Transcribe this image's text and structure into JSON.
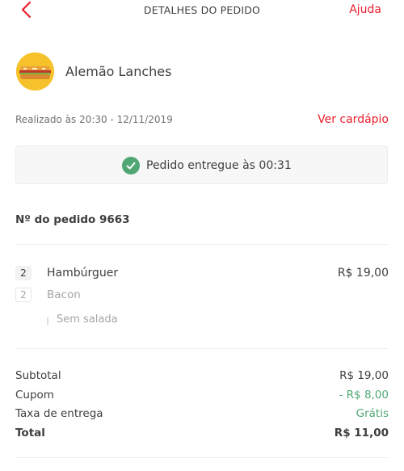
{
  "header": {
    "title": "DETALHES DO PEDIDO",
    "help_label": "Ajuda",
    "back_icon": "chevron-left-icon"
  },
  "colors": {
    "accent": "#ea1d2c",
    "success": "#50a773"
  },
  "store": {
    "name": "Alemão Lanches",
    "logo_icon": "sandwich-logo"
  },
  "order": {
    "placed_at": "Realizado às 20:30 - 12/11/2019",
    "menu_link": "Ver cardápio",
    "status": "Pedido entregue às 00:31",
    "number_label": "Nº do pedido 9663"
  },
  "items": [
    {
      "qty": "2",
      "name": "Hambúrguer",
      "price": "R$ 19,00",
      "subitems": [
        {
          "qty": "2",
          "name": "Bacon"
        }
      ],
      "note": "Sem salada"
    }
  ],
  "summary": {
    "subtotal_label": "Subtotal",
    "subtotal_value": "R$ 19,00",
    "coupon_label": "Cupom",
    "coupon_value": "- R$ 8,00",
    "delivery_label": "Taxa de entrega",
    "delivery_value": "Grátis",
    "total_label": "Total",
    "total_value": "R$ 11,00"
  }
}
